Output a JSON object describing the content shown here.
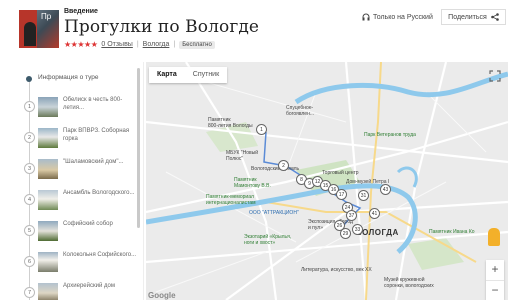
{
  "header": {
    "crumb": "Введение",
    "thumb_text": "Пр",
    "title": "Прогулки по Вологде",
    "stars": "★★★★★",
    "reviews": "0 Отзывы",
    "city": "Вологда",
    "price_badge": "Бесплатно",
    "language": "Только на Русский",
    "share": "Поделиться"
  },
  "sidebar": {
    "info": "Информация о туре",
    "stops": [
      {
        "num": "1",
        "label": "Обелиск в честь 800-летия..."
      },
      {
        "num": "2",
        "label": "Парк ВПВРЗ. Соборная горка"
      },
      {
        "num": "3",
        "label": "\"Шаламовский дом\"..."
      },
      {
        "num": "4",
        "label": "Ансамбль Вологодского..."
      },
      {
        "num": "5",
        "label": "Софийский собор"
      },
      {
        "num": "6",
        "label": "Колокольня Софийского..."
      },
      {
        "num": "7",
        "label": "Архиерейский дом"
      }
    ]
  },
  "map": {
    "tab_map": "Карта",
    "tab_satellite": "Спутник",
    "zoom_in": "+",
    "zoom_out": "−",
    "google": "Google",
    "city_label": "ВОЛОГДА",
    "labels": {
      "l1": "Спуцебное-\nбогоявлен...",
      "l2": "Памятник\n800-летия Вологды",
      "l3": "Парк Ветеранов труда",
      "l4": "МБУК \"Новый\nПолюс\"",
      "l5": "Вологодский Кремль",
      "l6": "Памятник\nМамонтову В.В.",
      "l7": "Памятник-мемориал\nинтернационалистам",
      "l8": "ООО \"АТТРАКЦИОН\"",
      "l9": "Экспозиция «Город\nи пул»",
      "l10": "Экзотарий «Крылья,\nноги и хвост»",
      "l11": "Литература, искусство, век ХХ",
      "l12": "Музей кружевной\nсоронки, вологодских",
      "l13": "Памятник Ивана Ко",
      "l14": "Торговый центр",
      "l15": "Дом-музей Петра I"
    },
    "pins": [
      "1",
      "2",
      "8",
      "9",
      "12",
      "15",
      "16",
      "17",
      "24",
      "26",
      "31",
      "37",
      "41",
      "43",
      "33",
      "29"
    ]
  }
}
